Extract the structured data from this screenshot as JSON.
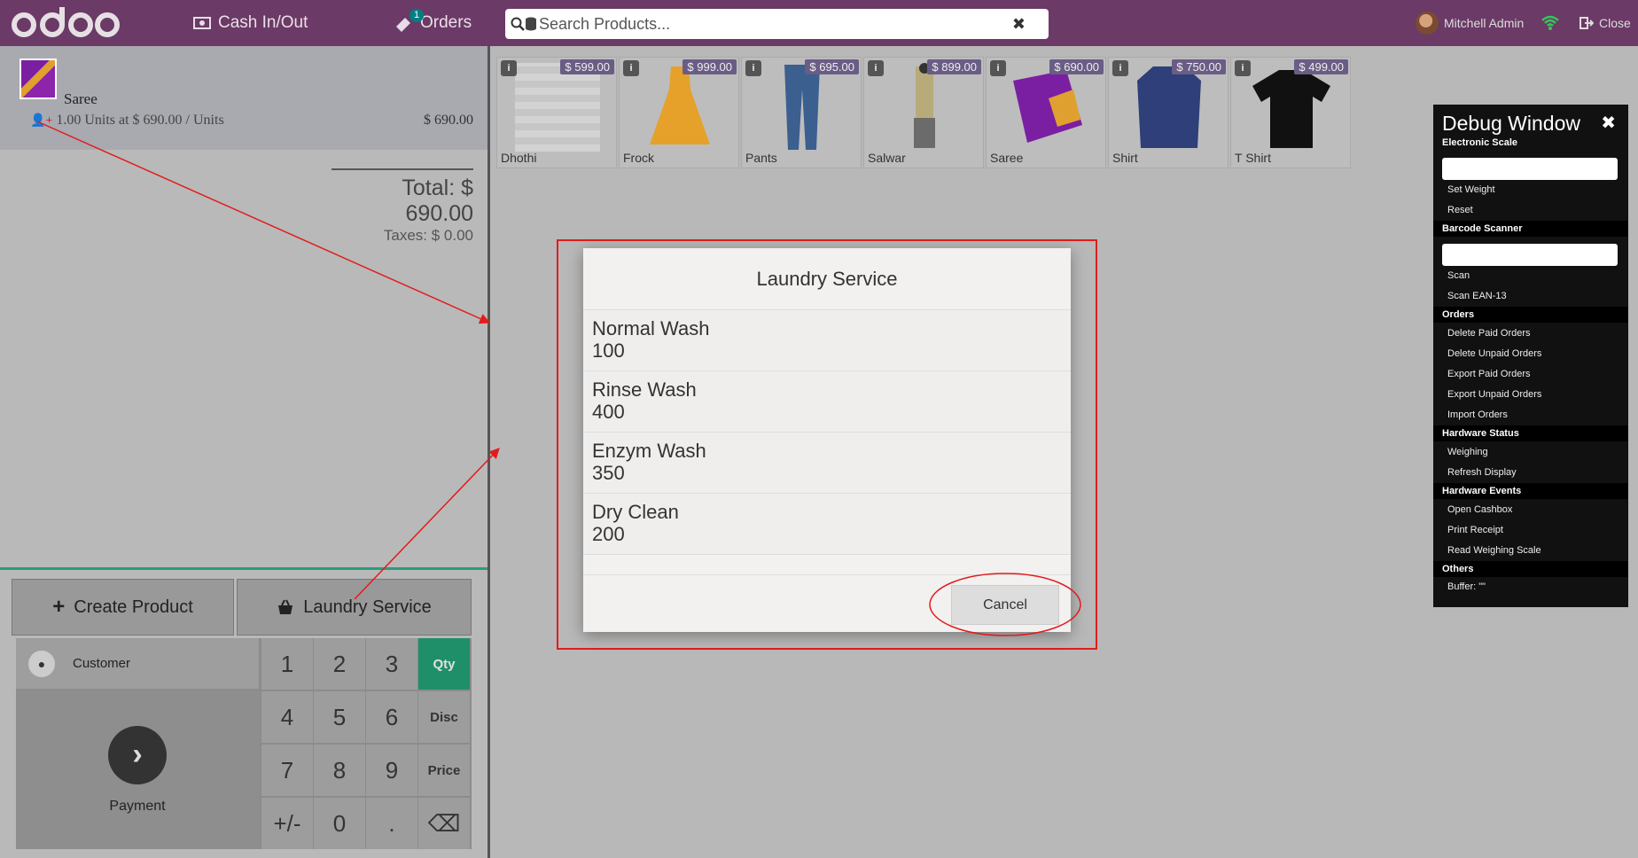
{
  "topbar": {
    "cash_label": "Cash In/Out",
    "orders_label": "Orders",
    "orders_count": "1",
    "search_placeholder": "Search Products...",
    "user_name": "Mitchell Admin",
    "close_label": "Close"
  },
  "order": {
    "line": {
      "name": "Saree",
      "detail": "1.00 Units at $ 690.00 / Units",
      "price": "$ 690.00"
    },
    "total": "Total: $ 690.00",
    "taxes": "Taxes: $ 0.00"
  },
  "controls": {
    "create_product": "Create Product",
    "laundry_service": "Laundry Service",
    "customer": "Customer",
    "payment": "Payment"
  },
  "numpad": {
    "keys": [
      "1",
      "2",
      "3",
      "Qty",
      "4",
      "5",
      "6",
      "Disc",
      "7",
      "8",
      "9",
      "Price",
      "+/-",
      "0",
      ".",
      "⌫"
    ],
    "active": "Qty"
  },
  "products": [
    {
      "name": "Dhothi",
      "price": "$ 599.00"
    },
    {
      "name": "Frock",
      "price": "$ 999.00"
    },
    {
      "name": "Pants",
      "price": "$ 695.00"
    },
    {
      "name": "Salwar",
      "price": "$ 899.00"
    },
    {
      "name": "Saree",
      "price": "$ 690.00"
    },
    {
      "name": "Shirt",
      "price": "$ 750.00"
    },
    {
      "name": "T Shirt",
      "price": "$ 499.00"
    }
  ],
  "modal": {
    "title": "Laundry Service",
    "services": [
      {
        "name": "Normal Wash",
        "price": "100"
      },
      {
        "name": "Rinse Wash",
        "price": "400"
      },
      {
        "name": "Enzym Wash",
        "price": "350"
      },
      {
        "name": "Dry Clean",
        "price": "200"
      }
    ],
    "cancel": "Cancel"
  },
  "debug": {
    "title": "Debug Window",
    "subtitle": "Electronic Scale",
    "set_weight": "Set Weight",
    "reset": "Reset",
    "barcode": "Barcode Scanner",
    "scan": "Scan",
    "scan_ean": "Scan EAN-13",
    "orders": "Orders",
    "delete_paid": "Delete Paid Orders",
    "delete_unpaid": "Delete Unpaid Orders",
    "export_paid": "Export Paid Orders",
    "export_unpaid": "Export Unpaid Orders",
    "import": "Import Orders",
    "hw_status": "Hardware Status",
    "weighing": "Weighing",
    "refresh": "Refresh Display",
    "hw_events": "Hardware Events",
    "open_cashbox": "Open Cashbox",
    "print_receipt": "Print Receipt",
    "read_scale": "Read Weighing Scale",
    "others": "Others",
    "buffer": "Buffer: \"\""
  },
  "colors": {
    "topbar": "#6b3a66",
    "accent": "#1f8f6a",
    "annotation": "#e21c1c"
  }
}
